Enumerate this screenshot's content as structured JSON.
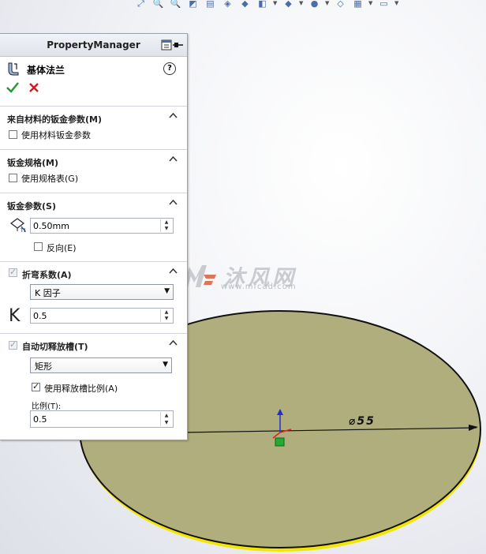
{
  "panel": {
    "header_title": "PropertyManager",
    "feature_title": "基体法兰",
    "help_label": "?"
  },
  "groups": {
    "material": {
      "title": "来自材料的钣金参数(M)",
      "checkbox_label": "使用材料钣金参数",
      "checked": false
    },
    "gauge": {
      "title": "钣金规格(M)",
      "checkbox_label": "使用规格表(G)",
      "checked": false
    },
    "sheet_params": {
      "title": "钣金参数(S)",
      "thickness_value": "0.50mm",
      "reverse_label": "反向(E)",
      "reverse_checked": false
    },
    "bend_allowance": {
      "title": "折弯系数(A)",
      "type_value": "K 因子",
      "k_symbol": "K",
      "k_value": "0.5",
      "enabled": true
    },
    "auto_relief": {
      "title": "自动切释放槽(T)",
      "type_value": "矩形",
      "ratio_checkbox_label": "使用释放槽比例(A)",
      "ratio_checked": true,
      "ratio_label": "比例(T):",
      "ratio_value": "0.5",
      "enabled": true
    }
  },
  "viewport": {
    "dimension_label": "⌀55",
    "watermark_text": "沐风网",
    "watermark_url": "www.mfcad.com",
    "colors": {
      "disk_fill": "#b0ae7c",
      "disk_edge": "#111111",
      "disk_highlight": "#f2e600",
      "axis_x": "#e02020",
      "axis_y": "#2030d0",
      "origin": "#22aa33"
    }
  },
  "toolbar": {
    "icons": [
      "zoom-to-fit-icon",
      "zoom-area-icon",
      "previous-view-icon",
      "section-view-icon",
      "dynamic-annotation-icon",
      "view-orientation-icon",
      "display-style-icon",
      "hide-show-icon",
      "edit-appearance-icon",
      "apply-scene-icon",
      "view-settings-icon",
      "display-manager-icon"
    ]
  }
}
